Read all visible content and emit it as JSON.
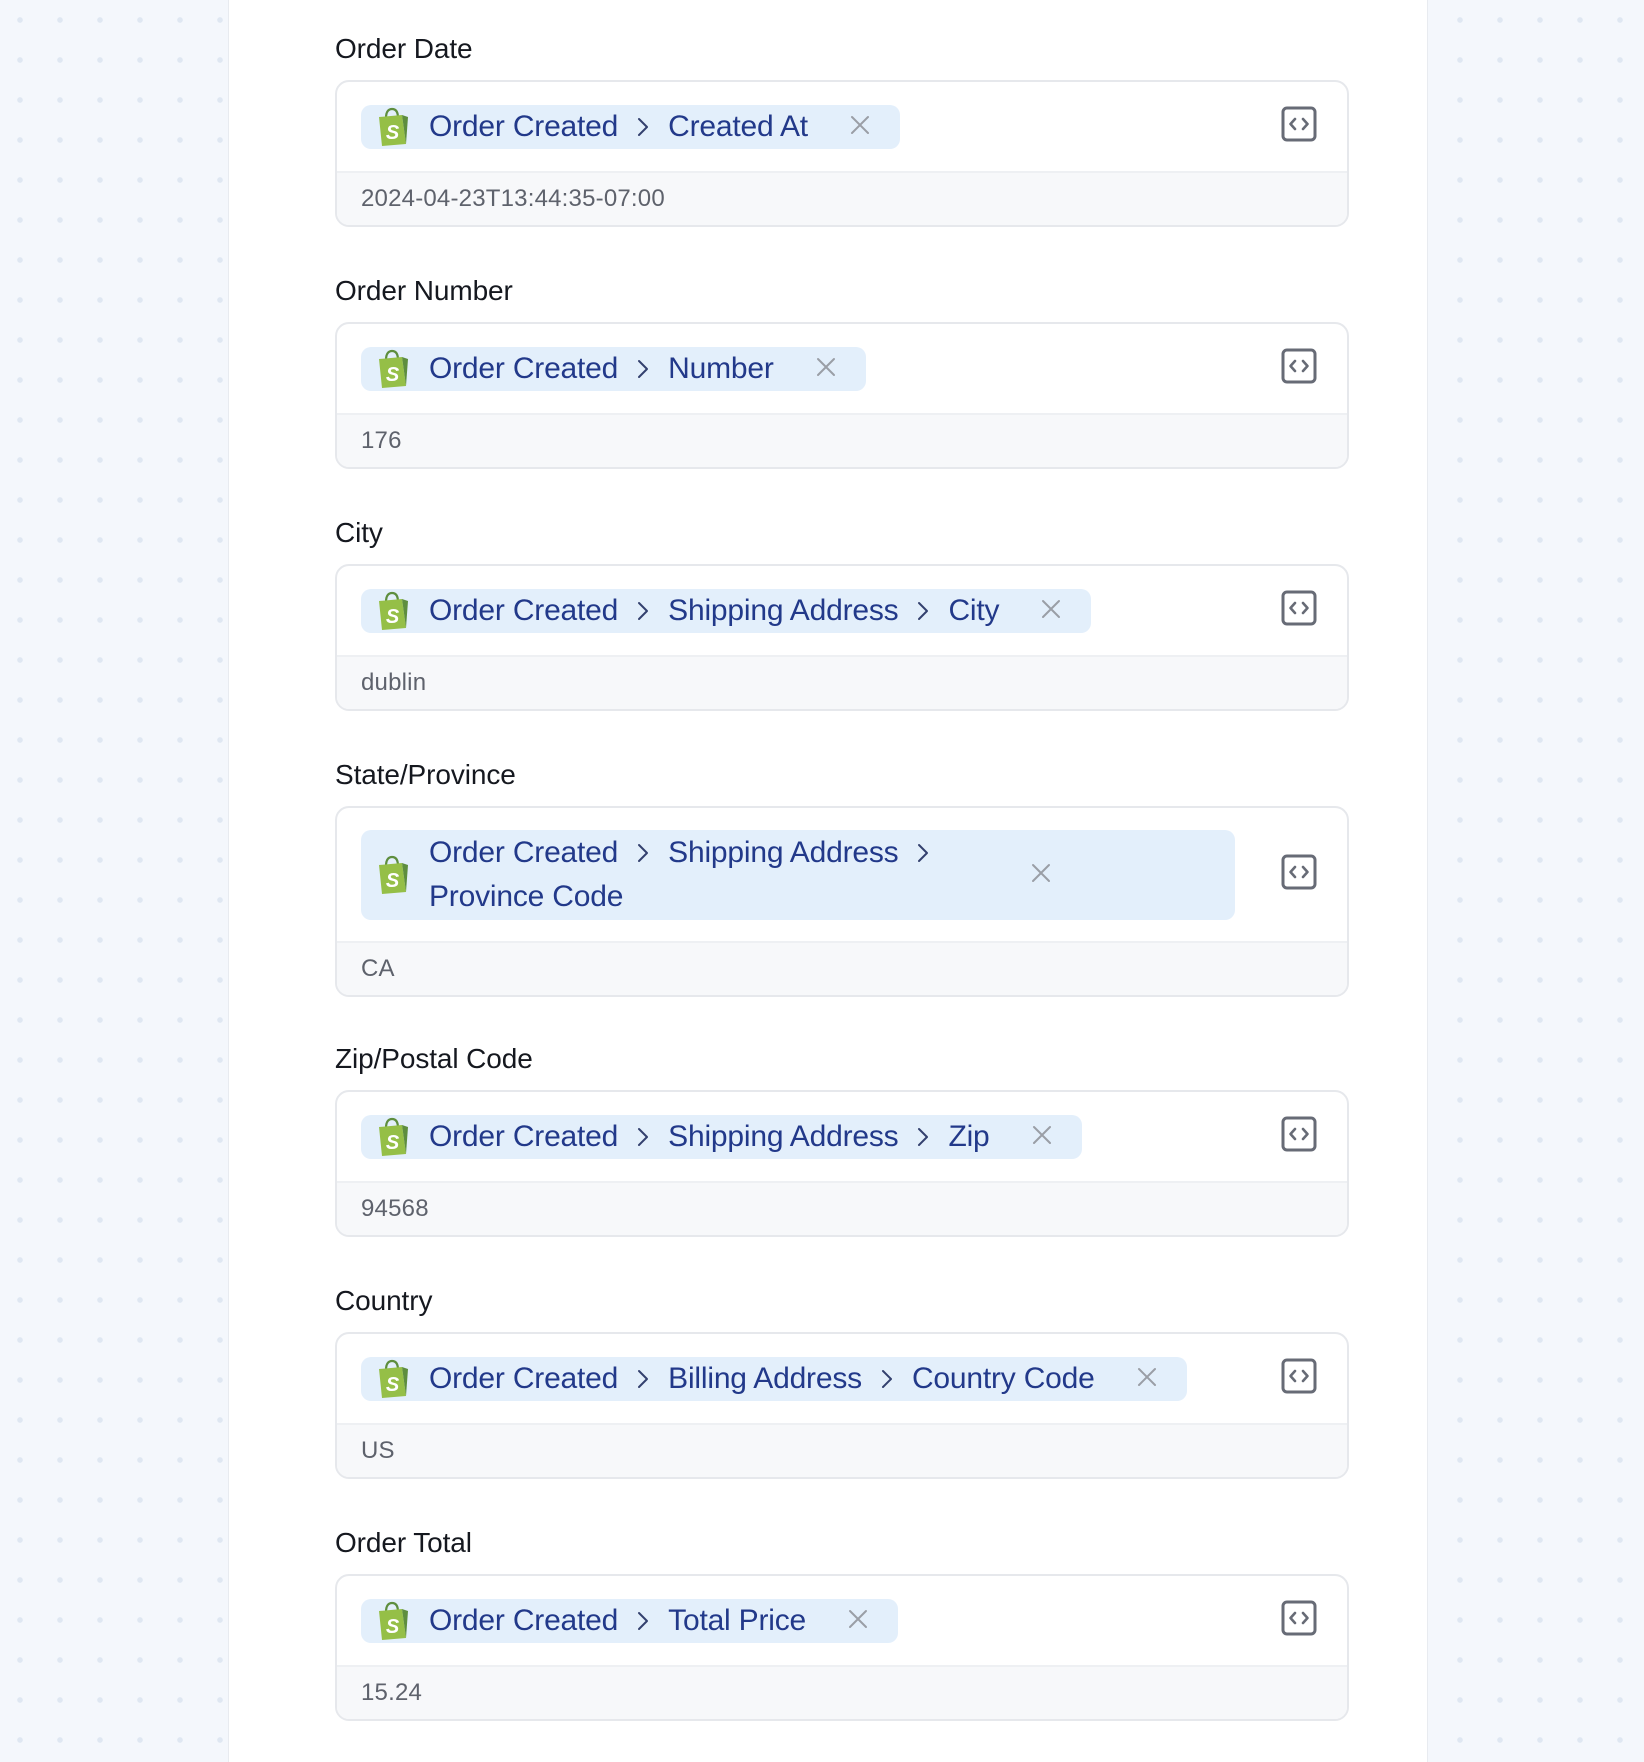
{
  "fields": [
    {
      "label": "Order Date",
      "source_app": "shopify",
      "path": [
        "Order Created",
        "Created At"
      ],
      "value": "2024-04-23T13:44:35-07:00"
    },
    {
      "label": "Order Number",
      "source_app": "shopify",
      "path": [
        "Order Created",
        "Number"
      ],
      "value": "176"
    },
    {
      "label": "City",
      "source_app": "shopify",
      "path": [
        "Order Created",
        "Shipping Address",
        "City"
      ],
      "value": "dublin"
    },
    {
      "label": "State/Province",
      "source_app": "shopify",
      "path": [
        "Order Created",
        "Shipping Address",
        "Province Code"
      ],
      "value": "CA"
    },
    {
      "label": "Zip/Postal Code",
      "source_app": "shopify",
      "path": [
        "Order Created",
        "Shipping Address",
        "Zip"
      ],
      "value": "94568"
    },
    {
      "label": "Country",
      "source_app": "shopify",
      "path": [
        "Order Created",
        "Billing Address",
        "Country Code"
      ],
      "value": "US"
    },
    {
      "label": "Order Total",
      "source_app": "shopify",
      "path": [
        "Order Created",
        "Total Price"
      ],
      "value": "15.24"
    }
  ],
  "icons": {
    "source": "shopify-bag-icon",
    "separator": "chevron-right-icon",
    "remove": "close-icon",
    "toggle_code": "code-brackets-icon"
  },
  "colors": {
    "pill_background": "#e3effb",
    "crumb_text": "#22398a",
    "shopify_green": "#95bf47",
    "shopify_dark_green": "#5e8e3e",
    "value_background": "#f7f8fa",
    "value_text": "#5e626c",
    "label_text": "#15181f",
    "icon_gray": "#676b76"
  }
}
